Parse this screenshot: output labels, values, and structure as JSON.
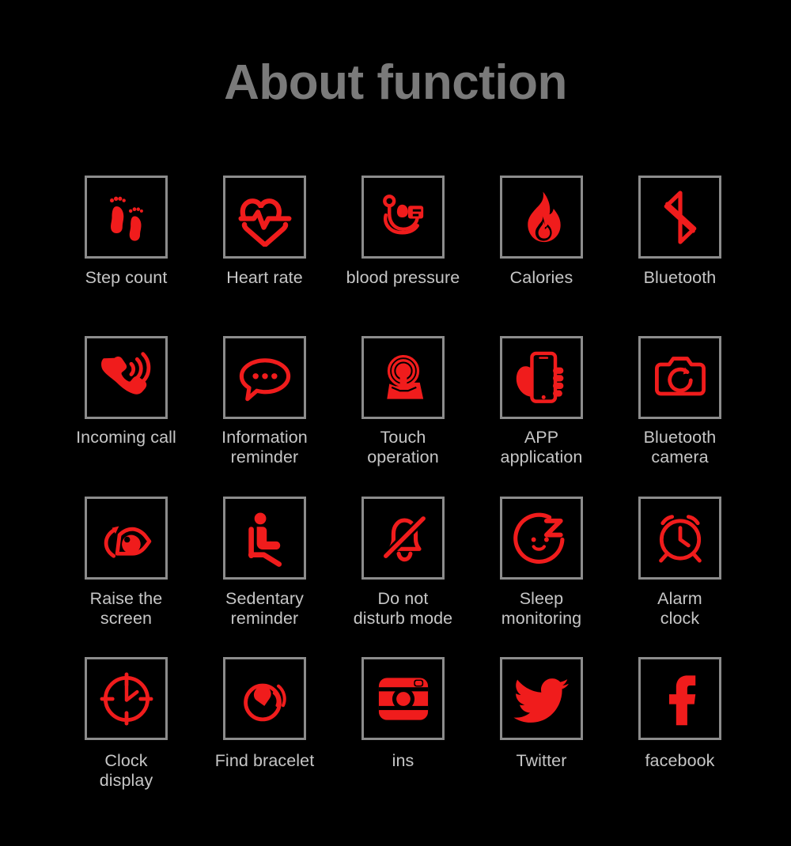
{
  "header": {
    "title": "About function",
    "title_color": "#7a7a7a"
  },
  "theme": {
    "background": "#000000",
    "icon_color": "#f01c1c",
    "box_border": "#8c8c8c",
    "label_color": "#c6c6c6"
  },
  "features": [
    {
      "label": "Step count",
      "icon": "footprints-icon"
    },
    {
      "label": "Heart rate",
      "icon": "heart-pulse-icon"
    },
    {
      "label": "blood pressure",
      "icon": "blood-pressure-monitor-icon"
    },
    {
      "label": "Calories",
      "icon": "flame-icon"
    },
    {
      "label": "Bluetooth",
      "icon": "bluetooth-icon"
    },
    {
      "label": "Incoming call",
      "icon": "phone-ringing-icon"
    },
    {
      "label": "Information\nreminder",
      "icon": "speech-bubble-icon"
    },
    {
      "label": "Touch\noperation",
      "icon": "touch-finger-icon"
    },
    {
      "label": "APP\napplication",
      "icon": "hand-holding-phone-icon"
    },
    {
      "label": "Bluetooth\ncamera",
      "icon": "camera-icon"
    },
    {
      "label": "Raise the\nscreen",
      "icon": "eye-rotate-icon"
    },
    {
      "label": "Sedentary\nreminder",
      "icon": "sitting-person-icon"
    },
    {
      "label": "Do not\ndisturb mode",
      "icon": "bell-muted-icon"
    },
    {
      "label": "Sleep\nmonitoring",
      "icon": "sleeping-face-icon"
    },
    {
      "label": "Alarm\nclock",
      "icon": "alarm-clock-icon"
    },
    {
      "label": "Clock\ndisplay",
      "icon": "clock-display-icon"
    },
    {
      "label": "Find bracelet",
      "icon": "vibrating-bracelet-icon"
    },
    {
      "label": "ins",
      "icon": "instagram-icon"
    },
    {
      "label": "Twitter",
      "icon": "twitter-bird-icon"
    },
    {
      "label": "facebook",
      "icon": "facebook-f-icon"
    }
  ]
}
